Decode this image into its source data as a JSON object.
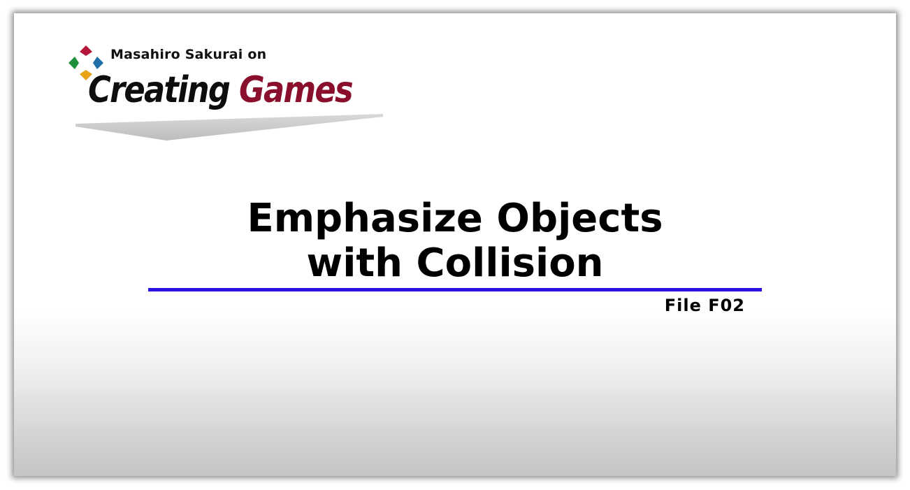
{
  "logo": {
    "author": "Masahiro Sakurai on",
    "title_word1": "Creating",
    "title_word2": "Games",
    "mark_colors": {
      "top": "#b5173a",
      "left": "#1e8f3a",
      "right": "#1f6fa8",
      "bottom": "#e8a317"
    }
  },
  "main": {
    "title_line1": "Emphasize Objects",
    "title_line2": "with Collision",
    "file_label": "File F02"
  },
  "colors": {
    "rule": "#2a12e0",
    "games_red": "#8a0f2c"
  }
}
